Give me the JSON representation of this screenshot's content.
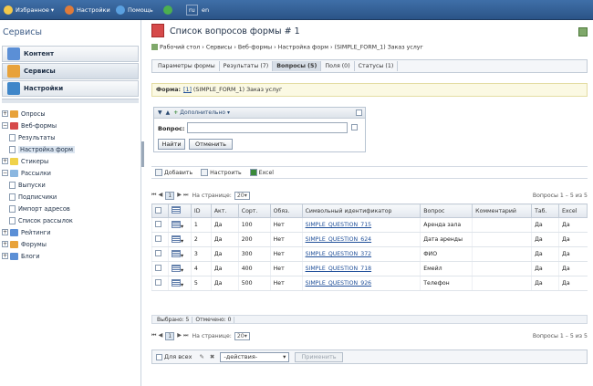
{
  "topbar": {
    "favorites": "Избранное",
    "settings": "Настройки",
    "help": "Помощь",
    "lang_ru": "ru",
    "lang_en": "en"
  },
  "sidebar": {
    "title": "Сервисы",
    "sections": [
      "Контент",
      "Сервисы",
      "Настройки"
    ],
    "tree": [
      {
        "label": "Опросы",
        "kind": "folder",
        "expand": "+"
      },
      {
        "label": "Веб-формы",
        "kind": "folder",
        "expand": "−"
      },
      {
        "label": "Результаты",
        "kind": "page",
        "expand": ""
      },
      {
        "label": "Настройка форм",
        "kind": "page",
        "expand": ""
      },
      {
        "label": "Стикеры",
        "kind": "folder",
        "expand": "+"
      },
      {
        "label": "Рассылки",
        "kind": "folder",
        "expand": "−"
      },
      {
        "label": "Выпуски",
        "kind": "page",
        "expand": ""
      },
      {
        "label": "Подписчики",
        "kind": "page",
        "expand": ""
      },
      {
        "label": "Импорт адресов",
        "kind": "page",
        "expand": ""
      },
      {
        "label": "Список рассылок",
        "kind": "page",
        "expand": ""
      },
      {
        "label": "Рейтинги",
        "kind": "folder",
        "expand": "+"
      },
      {
        "label": "Форумы",
        "kind": "folder",
        "expand": "+"
      },
      {
        "label": "Блоги",
        "kind": "folder",
        "expand": "+"
      }
    ]
  },
  "main": {
    "title": "Список вопросов формы # 1",
    "breadcrumb": "Рабочий стол › Сервисы › Веб-формы › Настройка форм › (SIMPLE_FORM_1) Заказ услуг",
    "tabs": [
      "Параметры формы",
      "Результаты (7)",
      "Вопросы (5)",
      "Поля (0)",
      "Статусы (1)"
    ],
    "form_label": "Форма:",
    "form_link": "[1]",
    "form_name": "(SIMPLE_FORM_1) Заказ услуг",
    "filter": {
      "extra": "Дополнительно",
      "question_label": "Вопрос:",
      "question_value": "",
      "find": "Найти",
      "cancel": "Отменить"
    },
    "toolbar": {
      "add": "Добавить",
      "configure": "Настроить",
      "excel": "Excel"
    },
    "pager": {
      "page_label": "На странице:",
      "page_size": "20",
      "current_page": "1",
      "summary": "Вопросы 1 – 5 из 5"
    },
    "columns": [
      "ID",
      "Акт.",
      "Сорт.",
      "Обяз.",
      "Символьный идентификатор",
      "Вопрос",
      "Комментарий",
      "Таб.",
      "Excel"
    ],
    "rows": [
      [
        "1",
        "Да",
        "100",
        "Нет",
        "SIMPLE_QUESTION_715",
        "Аренда зала",
        "",
        "Да",
        "Да"
      ],
      [
        "2",
        "Да",
        "200",
        "Нет",
        "SIMPLE_QUESTION_624",
        "Дата аренды",
        "",
        "Да",
        "Да"
      ],
      [
        "3",
        "Да",
        "300",
        "Нет",
        "SIMPLE_QUESTION_372",
        "ФИО",
        "",
        "Да",
        "Да"
      ],
      [
        "4",
        "Да",
        "400",
        "Нет",
        "SIMPLE_QUESTION_718",
        "Емейл",
        "",
        "Да",
        "Да"
      ],
      [
        "5",
        "Да",
        "500",
        "Нет",
        "SIMPLE_QUESTION_926",
        "Телефон",
        "",
        "Да",
        "Да"
      ]
    ],
    "stats": {
      "selected": "Выбрано: 5",
      "checked": "Отмечено: 0"
    },
    "actions": {
      "for_all": "Для всех",
      "action_select": "-действия-",
      "apply": "Применить"
    }
  }
}
